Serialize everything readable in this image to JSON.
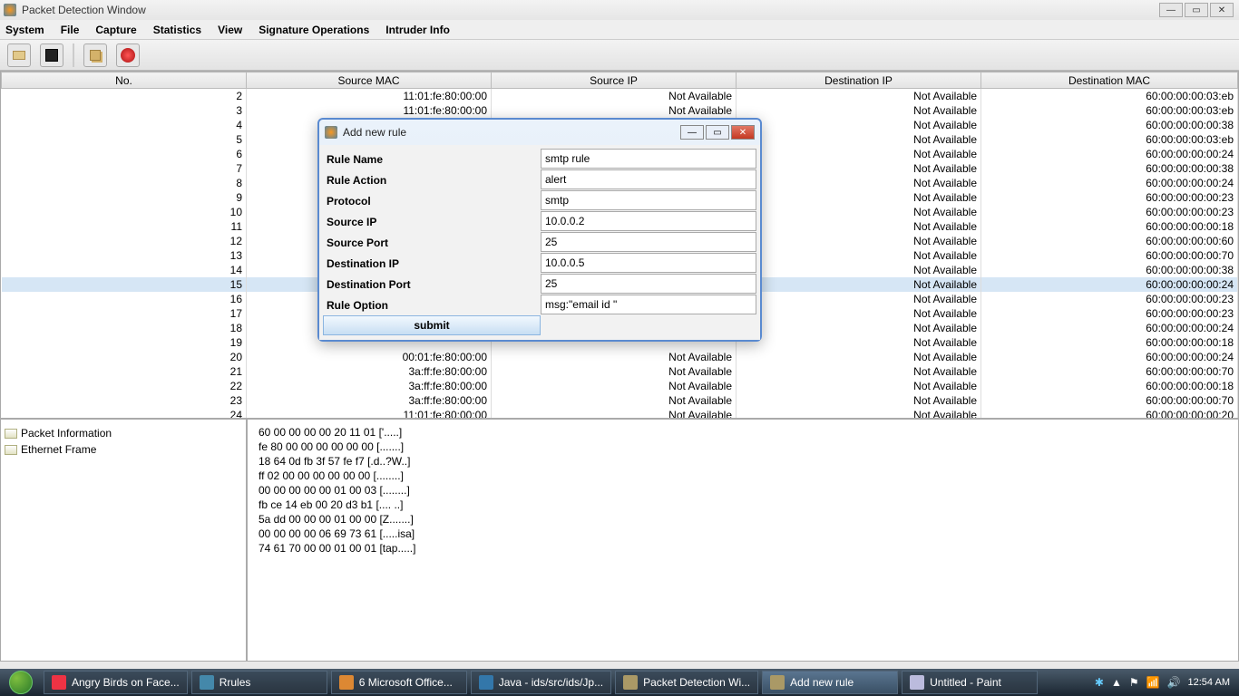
{
  "window": {
    "title": "Packet Detection Window"
  },
  "menu": [
    "System",
    "File",
    "Capture",
    "Statistics",
    "View",
    "Signature Operations",
    "Intruder Info"
  ],
  "columns": [
    "No.",
    "Source MAC",
    "Source IP",
    "Destination IP",
    "Destination MAC"
  ],
  "rows": [
    {
      "no": "2",
      "smac": "11:01:fe:80:00:00",
      "sip": "Not Available",
      "dip": "Not Available",
      "dmac": "60:00:00:00:03:eb"
    },
    {
      "no": "3",
      "smac": "11:01:fe:80:00:00",
      "sip": "Not Available",
      "dip": "Not Available",
      "dmac": "60:00:00:00:03:eb"
    },
    {
      "no": "4",
      "smac": "",
      "sip": "",
      "dip": "Not Available",
      "dmac": "60:00:00:00:00:38"
    },
    {
      "no": "5",
      "smac": "",
      "sip": "",
      "dip": "Not Available",
      "dmac": "60:00:00:00:03:eb"
    },
    {
      "no": "6",
      "smac": "",
      "sip": "",
      "dip": "Not Available",
      "dmac": "60:00:00:00:00:24"
    },
    {
      "no": "7",
      "smac": "",
      "sip": "",
      "dip": "Not Available",
      "dmac": "60:00:00:00:00:38"
    },
    {
      "no": "8",
      "smac": "",
      "sip": "",
      "dip": "Not Available",
      "dmac": "60:00:00:00:00:24"
    },
    {
      "no": "9",
      "smac": "",
      "sip": "",
      "dip": "Not Available",
      "dmac": "60:00:00:00:00:23"
    },
    {
      "no": "10",
      "smac": "",
      "sip": "",
      "dip": "Not Available",
      "dmac": "60:00:00:00:00:23"
    },
    {
      "no": "11",
      "smac": "",
      "sip": "",
      "dip": "Not Available",
      "dmac": "60:00:00:00:00:18"
    },
    {
      "no": "12",
      "smac": "",
      "sip": "",
      "dip": "Not Available",
      "dmac": "60:00:00:00:00:60"
    },
    {
      "no": "13",
      "smac": "",
      "sip": "",
      "dip": "Not Available",
      "dmac": "60:00:00:00:00:70"
    },
    {
      "no": "14",
      "smac": "",
      "sip": "",
      "dip": "Not Available",
      "dmac": "60:00:00:00:00:38"
    },
    {
      "no": "15",
      "smac": "",
      "sip": "",
      "dip": "Not Available",
      "dmac": "60:00:00:00:00:24",
      "selected": true
    },
    {
      "no": "16",
      "smac": "",
      "sip": "",
      "dip": "Not Available",
      "dmac": "60:00:00:00:00:23"
    },
    {
      "no": "17",
      "smac": "",
      "sip": "",
      "dip": "Not Available",
      "dmac": "60:00:00:00:00:23"
    },
    {
      "no": "18",
      "smac": "",
      "sip": "",
      "dip": "Not Available",
      "dmac": "60:00:00:00:00:24"
    },
    {
      "no": "19",
      "smac": "",
      "sip": "",
      "dip": "Not Available",
      "dmac": "60:00:00:00:00:18"
    },
    {
      "no": "20",
      "smac": "00:01:fe:80:00:00",
      "sip": "Not Available",
      "dip": "Not Available",
      "dmac": "60:00:00:00:00:24"
    },
    {
      "no": "21",
      "smac": "3a:ff:fe:80:00:00",
      "sip": "Not Available",
      "dip": "Not Available",
      "dmac": "60:00:00:00:00:70"
    },
    {
      "no": "22",
      "smac": "3a:ff:fe:80:00:00",
      "sip": "Not Available",
      "dip": "Not Available",
      "dmac": "60:00:00:00:00:18"
    },
    {
      "no": "23",
      "smac": "3a:ff:fe:80:00:00",
      "sip": "Not Available",
      "dip": "Not Available",
      "dmac": "60:00:00:00:00:70"
    },
    {
      "no": "24",
      "smac": "11:01:fe:80:00:00",
      "sip": "Not Available",
      "dip": "Not Available",
      "dmac": "60:00:00:00:00:20"
    }
  ],
  "tree": {
    "item1": "Packet Information",
    "item2": "Ethernet Frame"
  },
  "hex": [
    "60 00 00 00 00 20 11 01 ['.....]",
    "fe 80 00 00 00 00 00 00 [.......]",
    "18 64 0d fb 3f 57 fe f7 [.d..?W..]",
    "ff 02 00 00 00 00 00 00 [........]",
    "00 00 00 00 00 01 00 03 [........]",
    "fb ce 14 eb 00 20 d3 b1 [.... ..]",
    "5a dd 00 00 00 01 00 00 [Z.......]",
    "00 00 00 00 06 69 73 61 [.....isa]",
    "74 61 70 00 00 01 00 01 [tap.....]"
  ],
  "dialog": {
    "title": "Add new rule",
    "fields": {
      "rule_name": {
        "label": "Rule Name",
        "value": "smtp rule"
      },
      "rule_action": {
        "label": "Rule Action",
        "value": "alert"
      },
      "protocol": {
        "label": "Protocol",
        "value": "smtp"
      },
      "source_ip": {
        "label": "Source IP",
        "value": "10.0.0.2"
      },
      "source_port": {
        "label": "Source Port",
        "value": "25"
      },
      "dest_ip": {
        "label": "Destination IP",
        "value": "10.0.0.5"
      },
      "dest_port": {
        "label": "Destination Port",
        "value": "25"
      },
      "rule_option": {
        "label": "Rule Option",
        "value": "msg:\"email id \""
      }
    },
    "submit": "submit"
  },
  "taskbar": {
    "items": [
      {
        "label": "Angry Birds on Face...",
        "icon": "#e34"
      },
      {
        "label": "Rrules",
        "icon": "#48a"
      },
      {
        "label": "6 Microsoft Office...",
        "icon": "#d83"
      },
      {
        "label": "Java - ids/src/ids/Jp...",
        "icon": "#37a"
      },
      {
        "label": "Packet Detection Wi...",
        "icon": "#a96"
      },
      {
        "label": "Add new rule",
        "icon": "#a96",
        "active": true
      },
      {
        "label": "Untitled - Paint",
        "icon": "#bbd"
      }
    ],
    "clock": "12:54 AM"
  }
}
